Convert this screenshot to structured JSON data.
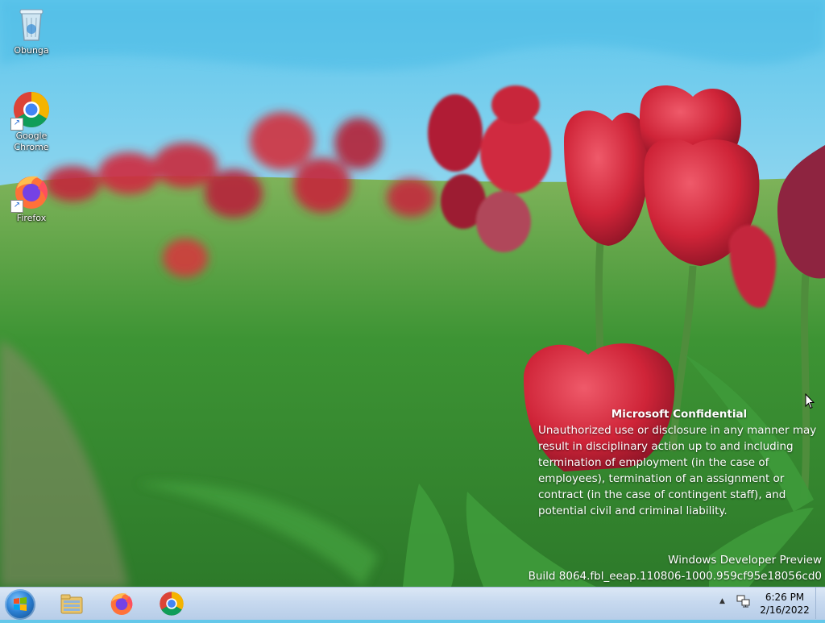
{
  "desktop": {
    "icons": [
      {
        "label": "Obunga",
        "icon": "recycle-bin-icon"
      },
      {
        "label": "Google Chrome",
        "icon": "chrome-icon"
      },
      {
        "label": "Firefox",
        "icon": "firefox-icon"
      }
    ]
  },
  "watermark": {
    "title": "Microsoft Confidential",
    "lines": [
      "Unauthorized use or disclosure in any manner may",
      "result in disciplinary action up to and including",
      "termination of employment (in the case of",
      "employees), termination of an assignment or",
      "contract (in the case of contingent staff), and",
      "potential civil and criminal liability."
    ],
    "product": "Windows Developer Preview",
    "build": "Build 8064.fbl_eeap.110806-1000.959cf95e18056cd0"
  },
  "taskbar": {
    "start_icon": "windows-start-orb-icon",
    "pinned": [
      {
        "name": "File Explorer",
        "icon": "file-explorer-icon"
      },
      {
        "name": "Firefox",
        "icon": "firefox-icon"
      },
      {
        "name": "Google Chrome",
        "icon": "chrome-icon"
      }
    ],
    "tray": {
      "chevron_glyph": "▲",
      "network_icon": "network-icon",
      "time": "6:26 PM",
      "date": "2/16/2022"
    }
  },
  "colors": {
    "sky": "#5cc4ea",
    "tulip": "#c8243a",
    "taskbar": "#c7d9ef"
  }
}
